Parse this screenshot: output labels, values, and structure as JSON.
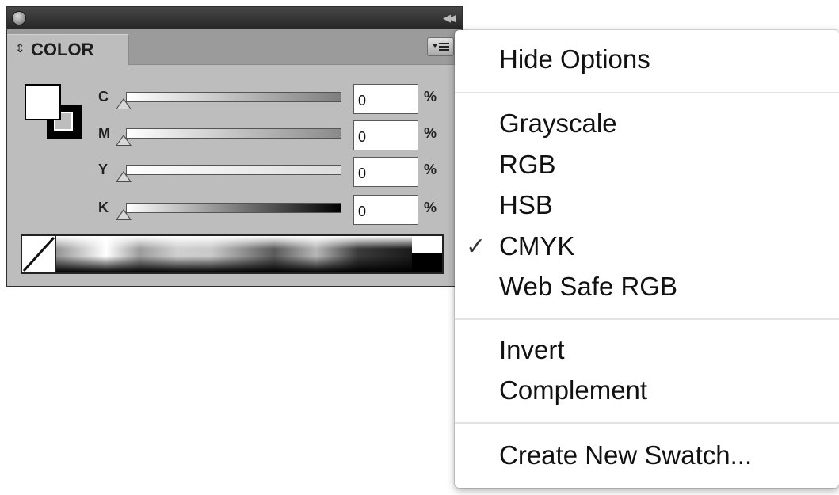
{
  "panel": {
    "tab_title": "COLOR",
    "channels": [
      {
        "label": "C",
        "value": "0",
        "unit": "%"
      },
      {
        "label": "M",
        "value": "0",
        "unit": "%"
      },
      {
        "label": "Y",
        "value": "0",
        "unit": "%"
      },
      {
        "label": "K",
        "value": "0",
        "unit": "%"
      }
    ],
    "icons": {
      "close": "close-circle-icon",
      "collapse": "double-chevron-left-icon",
      "tab_arrows": "up-down-arrows-icon",
      "menu": "panel-menu-icon"
    }
  },
  "menu": {
    "items": [
      {
        "label": "Hide Options",
        "checked": false
      },
      {
        "label": "Grayscale",
        "checked": false
      },
      {
        "label": "RGB",
        "checked": false
      },
      {
        "label": "HSB",
        "checked": false
      },
      {
        "label": "CMYK",
        "checked": true
      },
      {
        "label": "Web Safe RGB",
        "checked": false
      },
      {
        "label": "Invert",
        "checked": false
      },
      {
        "label": "Complement",
        "checked": false
      },
      {
        "label": "Create New Swatch...",
        "checked": false
      }
    ],
    "check_glyph": "✓"
  }
}
